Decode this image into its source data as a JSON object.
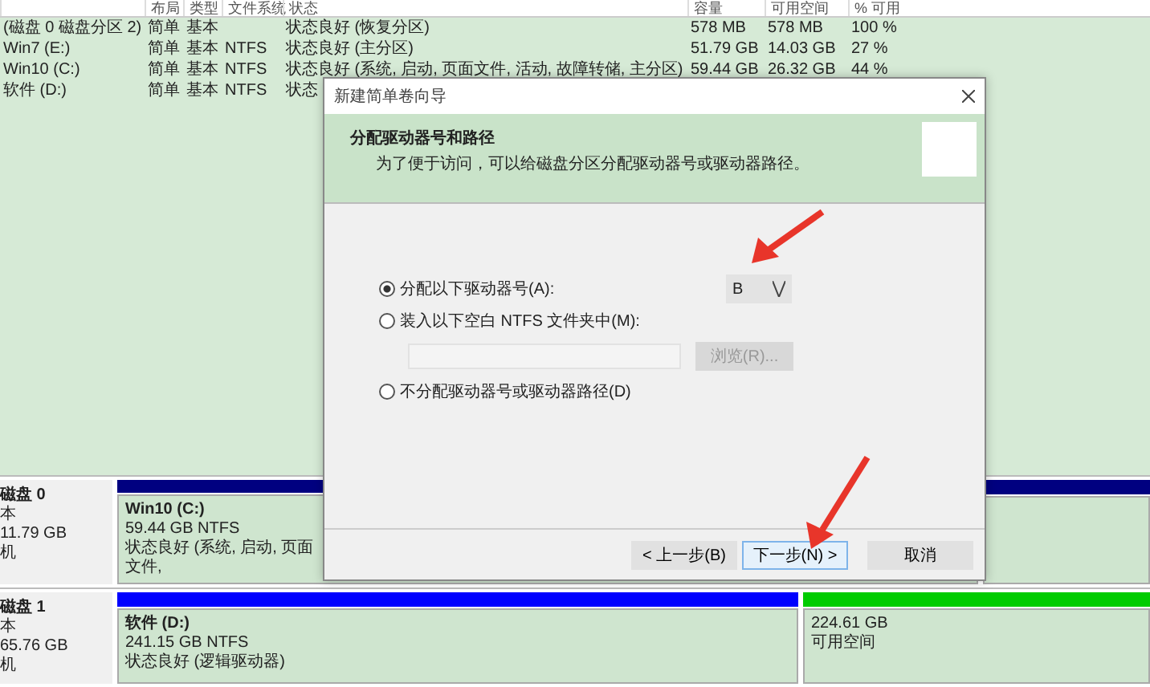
{
  "volume_table": {
    "columns": [
      "",
      "布局",
      "类型",
      "文件系统",
      "状态",
      "容量",
      "可用空间",
      "% 可用"
    ],
    "rows": [
      {
        "cells": [
          "(磁盘 0 磁盘分区 2)",
          "简单",
          "基本",
          "",
          "状态良好 (恢复分区)",
          "578 MB",
          "578 MB",
          "100 %"
        ]
      },
      {
        "cells": [
          "Win7 (E:)",
          "简单",
          "基本",
          "NTFS",
          "状态良好 (主分区)",
          "51.79 GB",
          "14.03 GB",
          "27 %"
        ]
      },
      {
        "cells": [
          "Win10 (C:)",
          "简单",
          "基本",
          "NTFS",
          "状态良好 (系统, 启动, 页面文件, 活动, 故障转储, 主分区)",
          "59.44 GB",
          "26.32 GB",
          "44 %"
        ]
      },
      {
        "cells": [
          "软件 (D:)",
          "简单",
          "基本",
          "NTFS",
          "状态"
        ]
      }
    ]
  },
  "disks": [
    {
      "name": "磁盘 0",
      "type": "本",
      "size": "11.79 GB",
      "status": "机",
      "partitions": [
        {
          "title": "Win10  (C:)",
          "size": "59.44 GB NTFS",
          "status": "状态良好 (系统, 启动, 页面文件,",
          "color": "#000080"
        },
        {
          "color": "#000080"
        }
      ]
    },
    {
      "name": "磁盘 1",
      "type": "本",
      "size": "65.76 GB",
      "status": "机",
      "partitions": [
        {
          "title": "软件  (D:)",
          "size": "241.15 GB NTFS",
          "status": "状态良好 (逻辑驱动器)",
          "color": "#0000ff"
        },
        {
          "size": "224.61 GB",
          "status": "可用空间",
          "color": "#00cc00"
        }
      ]
    }
  ],
  "dialog": {
    "title": "新建简单卷向导",
    "heading": "分配驱动器号和路径",
    "subheading": "为了便于访问，可以给磁盘分区分配驱动器号或驱动器路径。",
    "options": [
      {
        "label": "分配以下驱动器号(A):",
        "selected": true
      },
      {
        "label": "装入以下空白 NTFS 文件夹中(M):",
        "selected": false
      },
      {
        "label": "不分配驱动器号或驱动器路径(D)",
        "selected": false
      }
    ],
    "drive_letter": "B",
    "folder_field": {
      "disabled": true
    },
    "browse_button": {
      "label": "浏览(R)...",
      "disabled": true
    },
    "buttons": [
      {
        "label": "< 上一步(B)",
        "default": false
      },
      {
        "label": "下一步(N) >",
        "default": true
      },
      {
        "label": "取消",
        "default": false
      }
    ]
  }
}
